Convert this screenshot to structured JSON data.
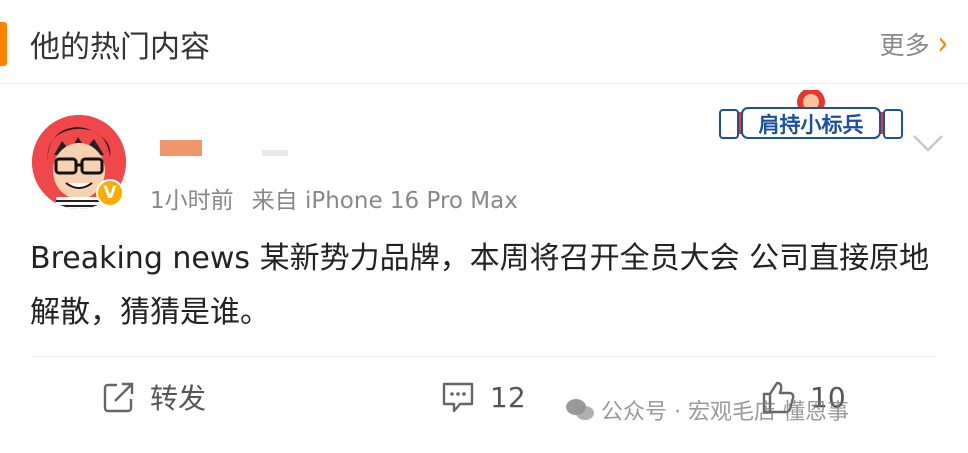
{
  "header": {
    "title": "他的热门内容",
    "more_label": "更多"
  },
  "post": {
    "time": "1小时前",
    "source": "来自 iPhone 16 Pro Max",
    "text": "Breaking news 某新势力品牌，本周将召开全员大会 公司直接原地解散，猜猜是谁。",
    "badge_text": "肩持小标兵",
    "verified_mark": "V"
  },
  "actions": {
    "repost_label": "转发",
    "comment_count": "12",
    "like_count": "10"
  },
  "watermark": {
    "text": "公众号 · 宏观毛店 懂恩事"
  },
  "colors": {
    "accent": "#ff8200",
    "badge_blue": "#1b4fa3",
    "badge_red": "#e8382c"
  }
}
